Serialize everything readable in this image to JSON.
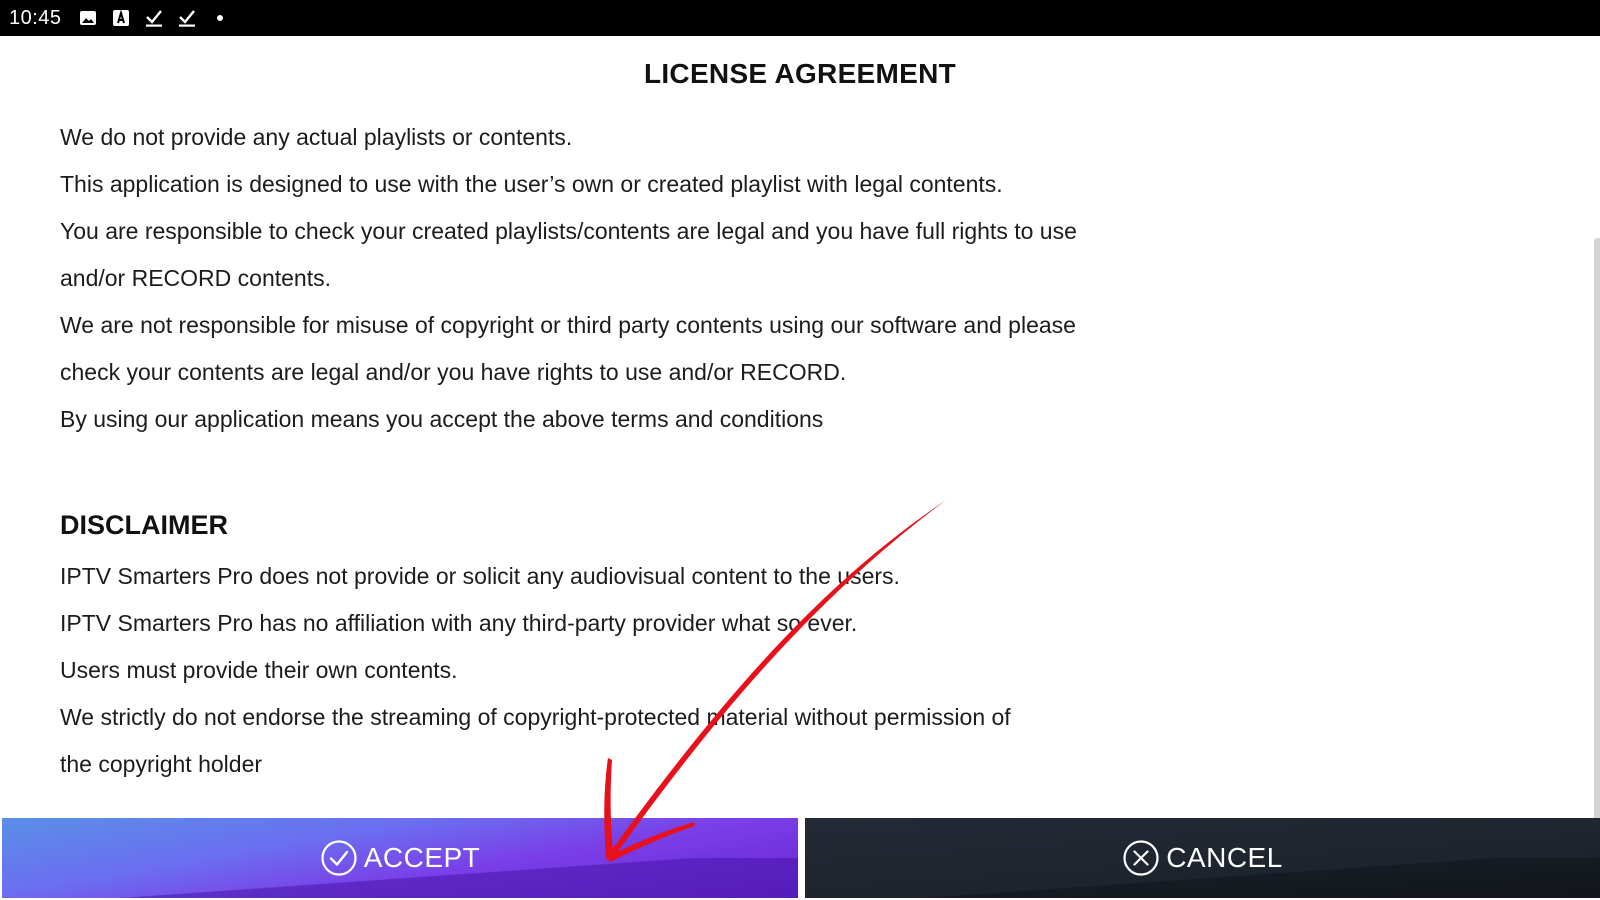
{
  "status_bar": {
    "time": "10:45",
    "icons": [
      "image-icon",
      "font-download-icon",
      "check-download-icon",
      "check-download-icon",
      "dot-icon"
    ]
  },
  "license": {
    "title": "LICENSE AGREEMENT",
    "paragraphs": [
      "We do not provide any actual playlists or contents.",
      "This application is designed to use with the user’s own or created playlist with legal contents.",
      "You are responsible to check your created playlists/contents are legal and you have full rights to use",
      "and/or RECORD contents.",
      "We are not responsible for misuse of copyright or third party contents using our software and please",
      "check your contents are legal and/or you have rights to use and/or RECORD.",
      "By using our application means you accept the above terms and conditions"
    ]
  },
  "disclaimer": {
    "heading": "DISCLAIMER",
    "paragraphs": [
      "IPTV Smarters Pro does not provide or solicit any audiovisual content to the users.",
      "IPTV Smarters Pro has no affiliation with any third-party provider what so ever.",
      "Users must provide their own contents.",
      "We strictly do not endorse the streaming of copyright-protected material without permission of",
      "the copyright holder"
    ]
  },
  "buttons": {
    "accept_label": "ACCEPT",
    "cancel_label": "CANCEL"
  },
  "colors": {
    "accept_gradient_start": "#5a8fe8",
    "accept_gradient_end": "#6a24d0",
    "cancel_background": "#1f252f",
    "annotation_arrow": "#e8101a"
  }
}
